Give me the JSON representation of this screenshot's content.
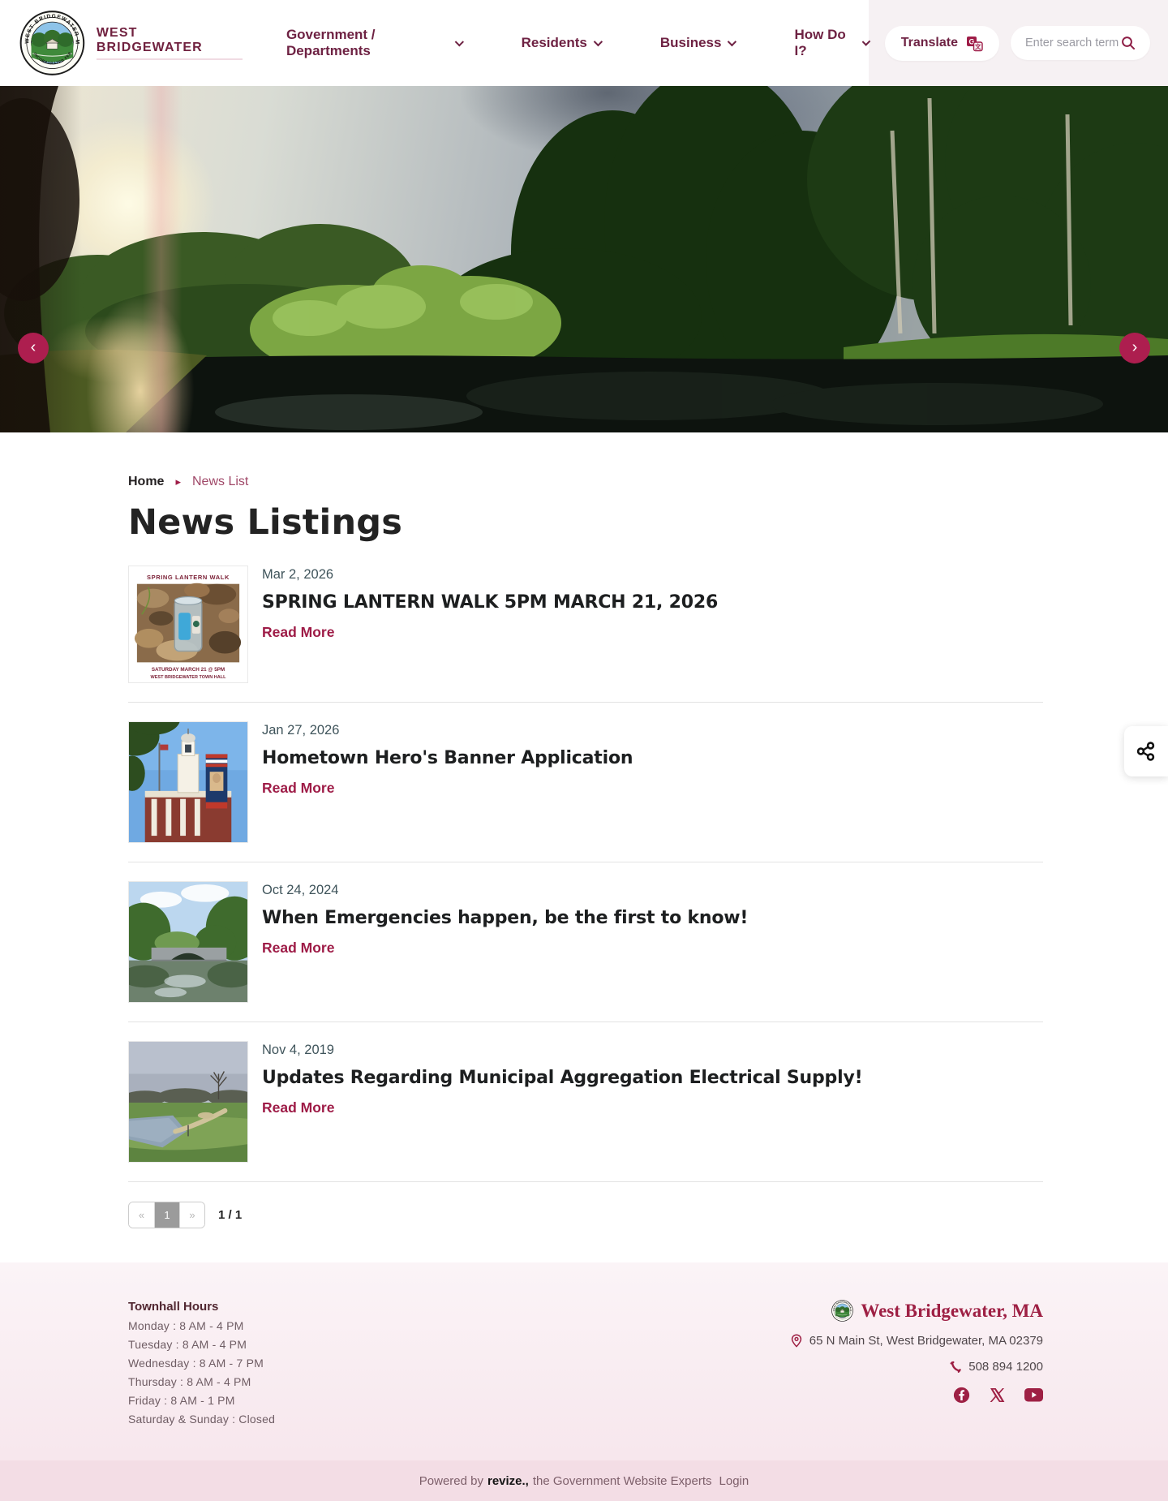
{
  "header": {
    "brand": "WEST BRIDGEWATER",
    "nav": [
      {
        "label": "Government / Departments"
      },
      {
        "label": "Residents"
      },
      {
        "label": "Business"
      },
      {
        "label": "How Do I?"
      }
    ],
    "translate_label": "Translate",
    "search_placeholder": "Enter search term"
  },
  "icons": {
    "carousel_prev": "‹",
    "carousel_next": "›",
    "breadcrumb_arrow": "▸",
    "pagination_prev": "«",
    "pagination_next": "»"
  },
  "breadcrumb": {
    "home": "Home",
    "current": "News List"
  },
  "page": {
    "title": "News Listings"
  },
  "news": {
    "items": [
      {
        "date": "Mar 2, 2026",
        "title": "SPRING LANTERN WALK 5PM MARCH 21, 2026",
        "read_more": "Read More",
        "thumb_caption_top": "SPRING LANTERN WALK",
        "thumb_caption_line1": "SATURDAY MARCH 21 @ 5PM",
        "thumb_caption_line2": "WEST BRIDGEWATER TOWN HALL"
      },
      {
        "date": "Jan 27, 2026",
        "title": "Hometown Hero's Banner Application",
        "read_more": "Read More"
      },
      {
        "date": "Oct 24, 2024",
        "title": "When Emergencies happen, be the first to know!",
        "read_more": "Read More"
      },
      {
        "date": "Nov 4, 2019",
        "title": "Updates Regarding Municipal Aggregation Electrical Supply!",
        "read_more": "Read More"
      }
    ],
    "pagination": {
      "prev": "«",
      "current": "1",
      "next": "»",
      "summary": "1 / 1"
    }
  },
  "footer": {
    "hours_title": "Townhall Hours",
    "hours": [
      "Monday : 8 AM - 4 PM",
      "Tuesday : 8 AM - 4 PM",
      "Wednesday : 8 AM - 7 PM",
      "Thursday : 8 AM - 4 PM",
      "Friday : 8 AM - 1 PM",
      "Saturday & Sunday : Closed"
    ],
    "org_name": "West Bridgewater, MA",
    "address": "65 N Main St, West Bridgewater, MA 02379",
    "phone": "508 894 1200",
    "powered_prefix": "Powered by",
    "powered_brand": "revize.,",
    "powered_suffix": "the Government Website Experts",
    "powered_login": "Login"
  },
  "colors": {
    "accent_crimson": "#9E1C47",
    "nav_maroon": "#6E2243",
    "carousel_button": "#AD1E4F",
    "footer_pink": "#F7E7ED"
  }
}
